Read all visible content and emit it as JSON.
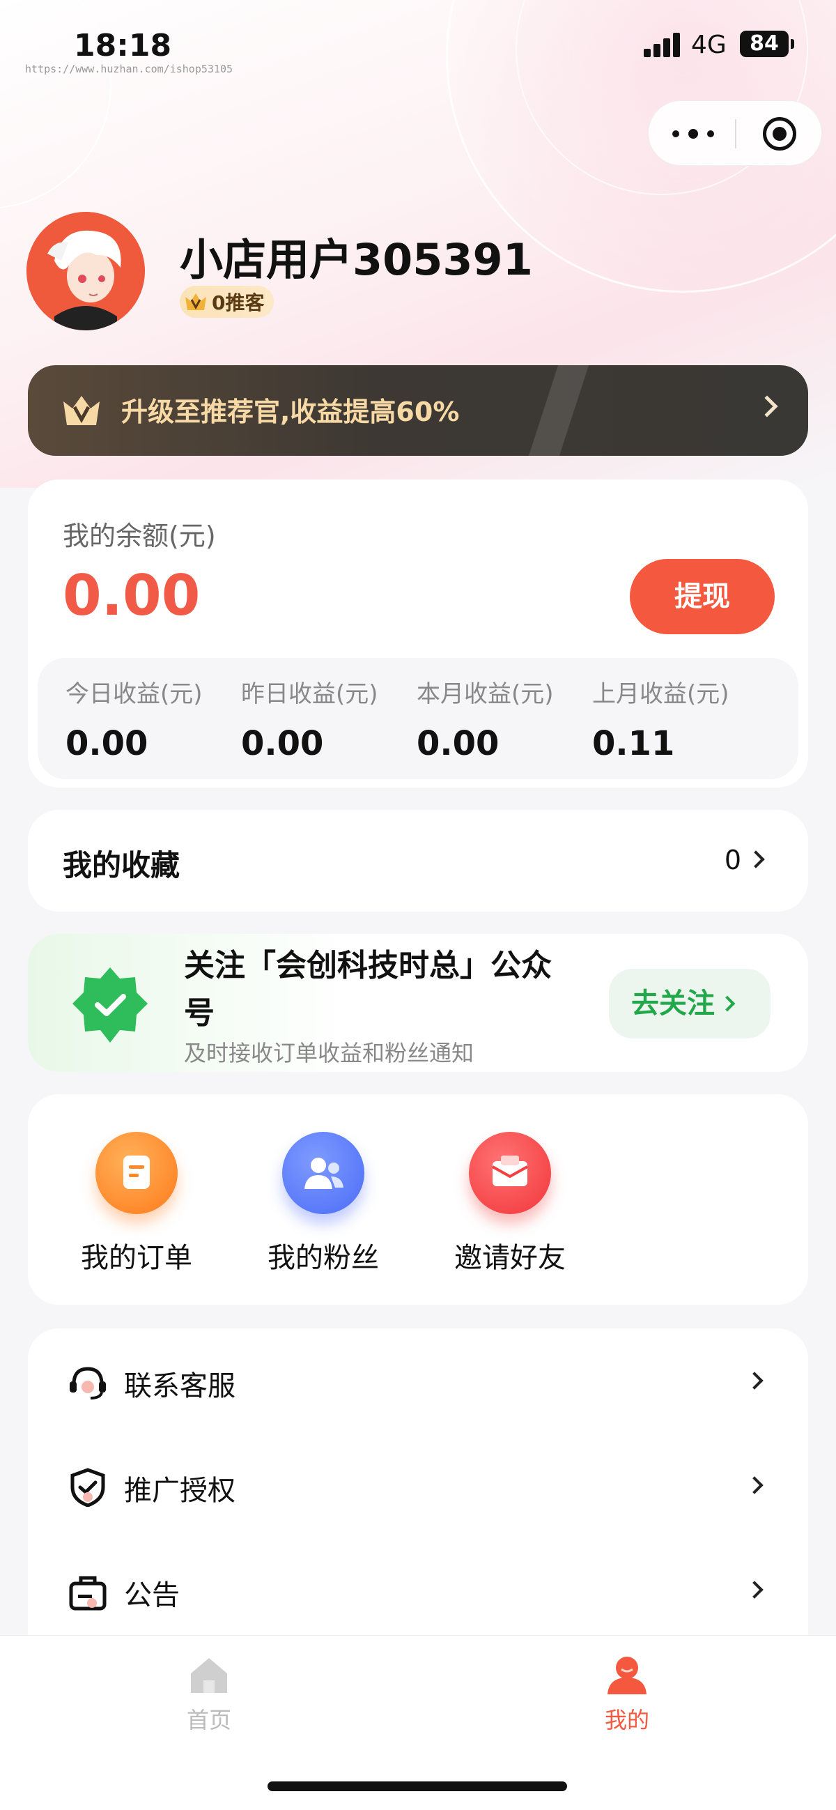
{
  "status_bar": {
    "time": "18:18",
    "url": "https://www.huzhan.com/ishop53105",
    "network": "4G",
    "battery": "84"
  },
  "profile": {
    "username": "小店用户305391",
    "level": "0推客"
  },
  "upgrade_banner": {
    "text": "升级至推荐官,收益提高60%"
  },
  "balance": {
    "label": "我的余额(元)",
    "value": "0.00",
    "withdraw_label": "提现",
    "earnings": [
      {
        "label": "今日收益(元)",
        "value": "0.00"
      },
      {
        "label": "昨日收益(元)",
        "value": "0.00"
      },
      {
        "label": "本月收益(元)",
        "value": "0.00"
      },
      {
        "label": "上月收益(元)",
        "value": "0.11"
      }
    ]
  },
  "favorites": {
    "label": "我的收藏",
    "count": "0"
  },
  "follow": {
    "title": "关注「会创科技时总」公众号",
    "subtitle": "及时接收订单收益和粉丝通知",
    "button": "去关注"
  },
  "tools": [
    {
      "label": "我的订单",
      "icon": "order-icon",
      "color": "#ff8a2a"
    },
    {
      "label": "我的粉丝",
      "icon": "fans-icon",
      "color": "#5577ff"
    },
    {
      "label": "邀请好友",
      "icon": "invite-icon",
      "color": "#f53f3f"
    }
  ],
  "menu": [
    {
      "label": "联系客服",
      "icon": "headset-icon"
    },
    {
      "label": "推广授权",
      "icon": "shield-check-icon"
    },
    {
      "label": "公告",
      "icon": "notice-icon"
    }
  ],
  "tabbar": {
    "tabs": [
      {
        "label": "首页",
        "icon": "home-icon",
        "active": false
      },
      {
        "label": "我的",
        "icon": "user-icon",
        "active": true
      }
    ]
  },
  "colors": {
    "accent": "#f4583e",
    "green": "#22a84a",
    "inactive": "#bbbbbb"
  }
}
